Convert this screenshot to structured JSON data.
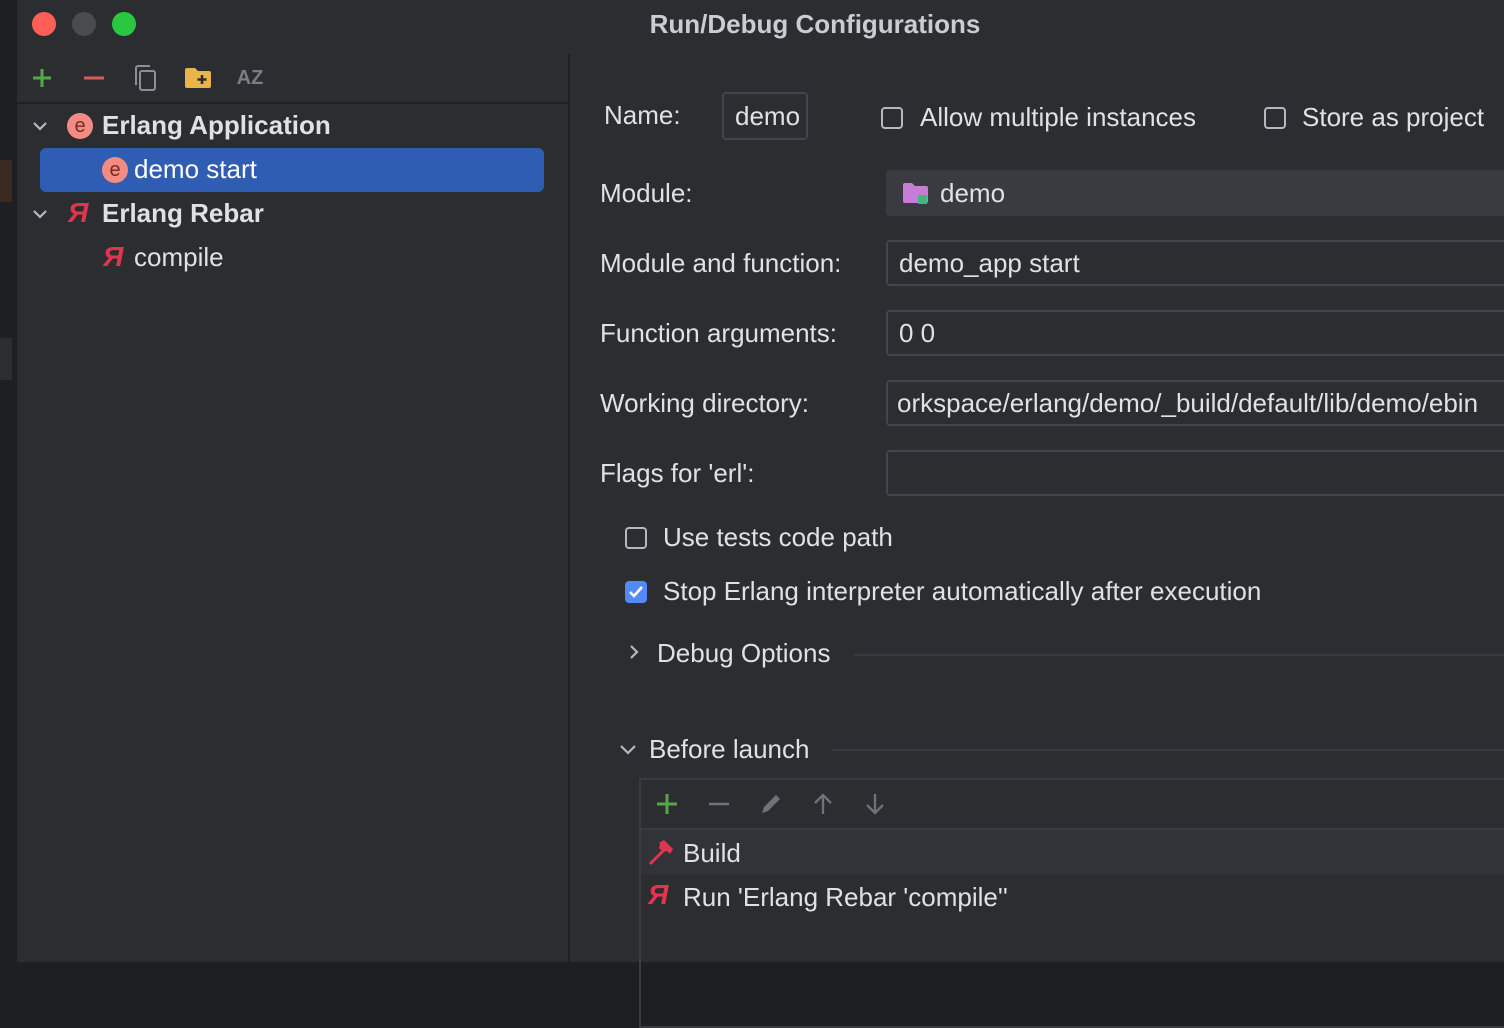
{
  "window": {
    "title": "Run/Debug Configurations"
  },
  "toolbar": {
    "add_icon": "plus-icon",
    "remove_icon": "minus-icon",
    "copy_icon": "copy-icon",
    "folder_icon": "new-folder-icon",
    "sort_icon": "sort-az-icon",
    "sort_label": "AZ"
  },
  "tree": {
    "groups": [
      {
        "label": "Erlang Application",
        "badge": "e",
        "items": [
          {
            "label": "demo start",
            "badge": "e",
            "selected": true
          }
        ]
      },
      {
        "label": "Erlang Rebar",
        "badge": "Я",
        "items": [
          {
            "label": "compile",
            "badge": "Я"
          }
        ]
      }
    ]
  },
  "form": {
    "name_label": "Name:",
    "name_value": "demo",
    "allow_multiple_label": "Allow multiple instances",
    "allow_multiple_checked": false,
    "store_project_label": "Store as project",
    "store_project_checked": false,
    "module_label": "Module:",
    "module_value": "demo",
    "module_func_label": "Module and function:",
    "module_func_value": "demo_app start",
    "func_args_label": "Function arguments:",
    "func_args_value": "0 0",
    "workdir_label": "Working directory:",
    "workdir_value": "orkspace/erlang/demo/_build/default/lib/demo/ebin",
    "flags_label": "Flags for 'erl':",
    "flags_value": "",
    "tests_path_label": "Use tests code path",
    "tests_path_checked": false,
    "stop_interp_label": "Stop Erlang interpreter automatically after execution",
    "stop_interp_checked": true,
    "debug_options_label": "Debug Options",
    "before_launch_label": "Before launch"
  },
  "before_launch": {
    "toolbar_icons": [
      "plus-icon",
      "minus-icon",
      "pencil-icon",
      "arrow-up-icon",
      "arrow-down-icon"
    ],
    "items": [
      {
        "label": "Build",
        "icon": "hammer-icon"
      },
      {
        "label": "Run 'Erlang Rebar 'compile''",
        "icon": "rebar-icon"
      }
    ]
  },
  "colors": {
    "background": "#2b2d30",
    "selection": "#2e5db3",
    "accent_green": "#57a64a",
    "accent_red": "#db5c5c",
    "erlang_badge": "#f28c82",
    "rebar_red": "#e0344f",
    "checkbox_blue": "#548af7"
  }
}
